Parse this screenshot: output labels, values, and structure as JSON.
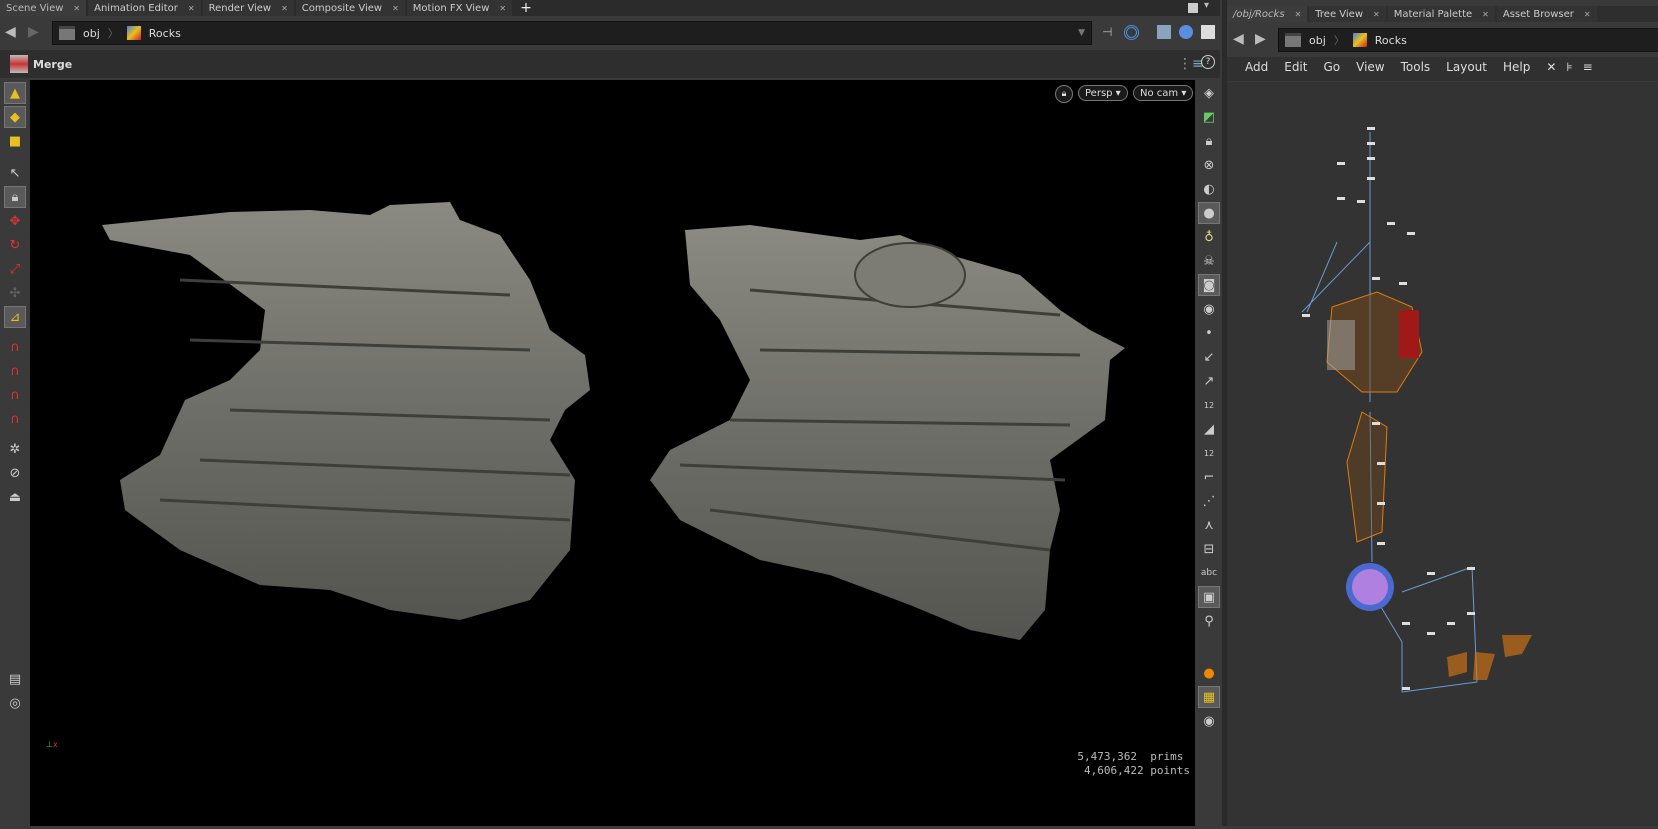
{
  "left_tabs": [
    {
      "label": "Scene View"
    },
    {
      "label": "Animation Editor"
    },
    {
      "label": "Render View"
    },
    {
      "label": "Composite View"
    },
    {
      "label": "Motion FX View"
    }
  ],
  "right_tabs": [
    {
      "label": "/obj/Rocks"
    },
    {
      "label": "Tree View"
    },
    {
      "label": "Material Palette"
    },
    {
      "label": "Asset Browser"
    }
  ],
  "path": {
    "root": "obj",
    "node": "Rocks"
  },
  "tool_header": {
    "label": "Merge"
  },
  "viewport": {
    "camera_view": "Persp ▾",
    "camera": "No cam ▾",
    "prims_count": "5,473,362",
    "prims_label": "prims",
    "points_count": "4,606,422",
    "points_label": "points"
  },
  "network_menu": [
    "Add",
    "Edit",
    "Go",
    "View",
    "Tools",
    "Layout",
    "Help"
  ],
  "right_toolbar": {
    "abc_label": "abc",
    "num12": "12"
  }
}
